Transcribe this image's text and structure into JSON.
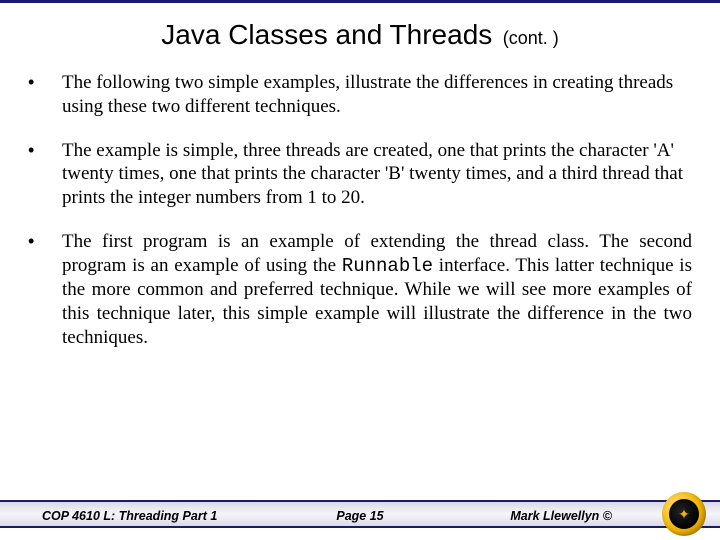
{
  "title": "Java Classes and Threads",
  "title_suffix": "(cont. )",
  "bullets": [
    {
      "text": "The following two simple examples, illustrate the differences in creating threads using these two different techniques.",
      "justify": false
    },
    {
      "text": "The example is simple, three threads are created, one that prints the character 'A' twenty times, one that prints the character 'B' twenty times, and a third thread that prints the integer numbers from 1 to 20.",
      "justify": false
    },
    {
      "text_pre": "The first program is an example of extending the thread class. The second program is an example of using the ",
      "text_code": "Runnable",
      "text_post": " interface.  This latter technique is the more common and preferred technique.  While we will see more examples of this technique later, this simple example will illustrate the difference in the two techniques.",
      "justify": true
    }
  ],
  "footer": {
    "left": "COP 4610 L: Threading Part 1",
    "center": "Page 15",
    "right": "Mark Llewellyn ©"
  }
}
